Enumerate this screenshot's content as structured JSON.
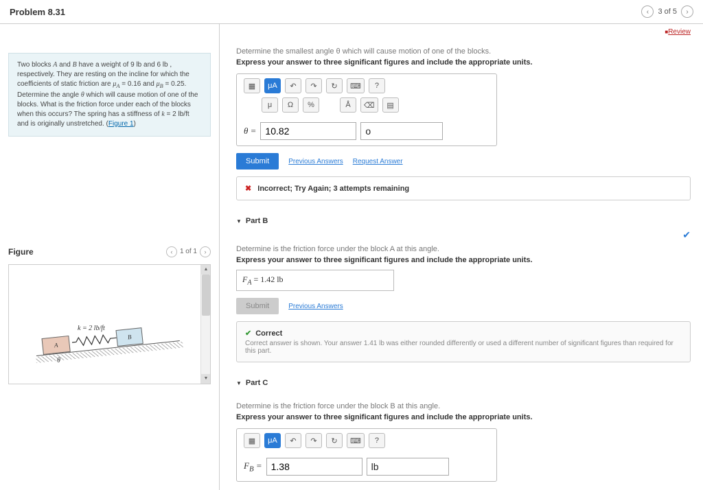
{
  "header": {
    "title": "Problem 8.31",
    "counter": "3 of 5"
  },
  "review": "Review",
  "problem": {
    "text_html": "Two blocks <span class='ital serif'>A</span> and <span class='ital serif'>B</span> have a weight of 9 lb and 6 lb , respectively. They are resting on the incline for which the coefficients of static friction are <span class='ital serif'>μ<sub>A</sub></span> = 0.16 and <span class='ital serif'>μ<sub>B</sub></span> = 0.25. Determine the angle <span class='ital serif'>θ</span> which will cause motion of one of the blocks. What is the friction force under each of the blocks when this occurs? The spring has a stiffness of <span class='ital serif'>k</span> = 2 lb/ft and is originally unstretched. (<a href='#'>Figure 1</a>)"
  },
  "figure": {
    "title": "Figure",
    "counter": "1 of 1",
    "k_label": "k = 2 lb/ft",
    "blockA": "A",
    "blockB": "B",
    "theta": "θ"
  },
  "partA": {
    "prompt": "Determine the smallest angle θ which will cause motion of one of the blocks.",
    "bold": "Express your answer to three significant figures and include the appropriate units.",
    "theta_label": "θ =",
    "value": "10.82",
    "unit": "o",
    "submit": "Submit",
    "prev": "Previous Answers",
    "req": "Request Answer",
    "feedback": "Incorrect; Try Again; 3 attempts remaining",
    "tool_mu_a": "μA",
    "tool_q": "?",
    "t_mu": "μ",
    "t_omega": "Ω",
    "t_pct": "%",
    "t_A": "Å",
    "t_x": "⌫"
  },
  "partB": {
    "title": "Part B",
    "prompt": "Determine is the friction force under the block A at this angle.",
    "bold": "Express your answer to three significant figures and include the appropriate units.",
    "answer": "F_A = 1.42 lb",
    "submit": "Submit",
    "prev": "Previous Answers",
    "correct_title": "Correct",
    "correct_msg": "Correct answer is shown. Your answer 1.41 lb was either rounded differently or used a different number of significant figures than required for this part."
  },
  "partC": {
    "title": "Part C",
    "prompt": "Determine is the friction force under the block B at this angle.",
    "bold": "Express your answer to three significant figures and include the appropriate units.",
    "label": "F_B =",
    "value": "1.38",
    "unit": "lb"
  }
}
